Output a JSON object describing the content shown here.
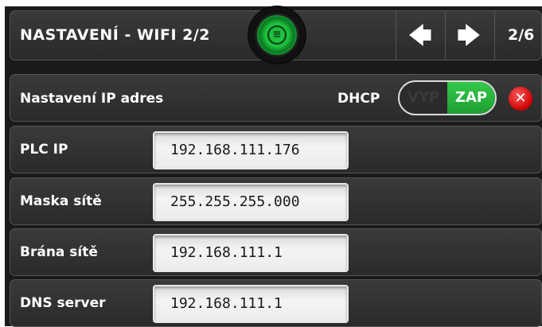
{
  "header": {
    "title": "NASTAVENÍ - WIFI 2/2",
    "page_indicator": "2/6",
    "prev_icon": "arrow-left-icon",
    "next_icon": "arrow-right-icon",
    "menu_icon": "menu-icon"
  },
  "ip_settings": {
    "label": "Nastavení IP adres",
    "dhcp_label": "DHCP",
    "toggle_off": "VYP",
    "toggle_on": "ZAP",
    "toggle_state": "ZAP"
  },
  "fields": [
    {
      "label": "PLC IP",
      "value": "192.168.111.176"
    },
    {
      "label": "Maska sítě",
      "value": "255.255.255.000"
    },
    {
      "label": "Brána sítě",
      "value": "192.168.111.1"
    },
    {
      "label": "DNS server",
      "value": "192.168.111.1"
    }
  ],
  "colors": {
    "accent_green": "#1e9e32",
    "close_red": "#cc0000",
    "background": "#1a1a1a"
  }
}
